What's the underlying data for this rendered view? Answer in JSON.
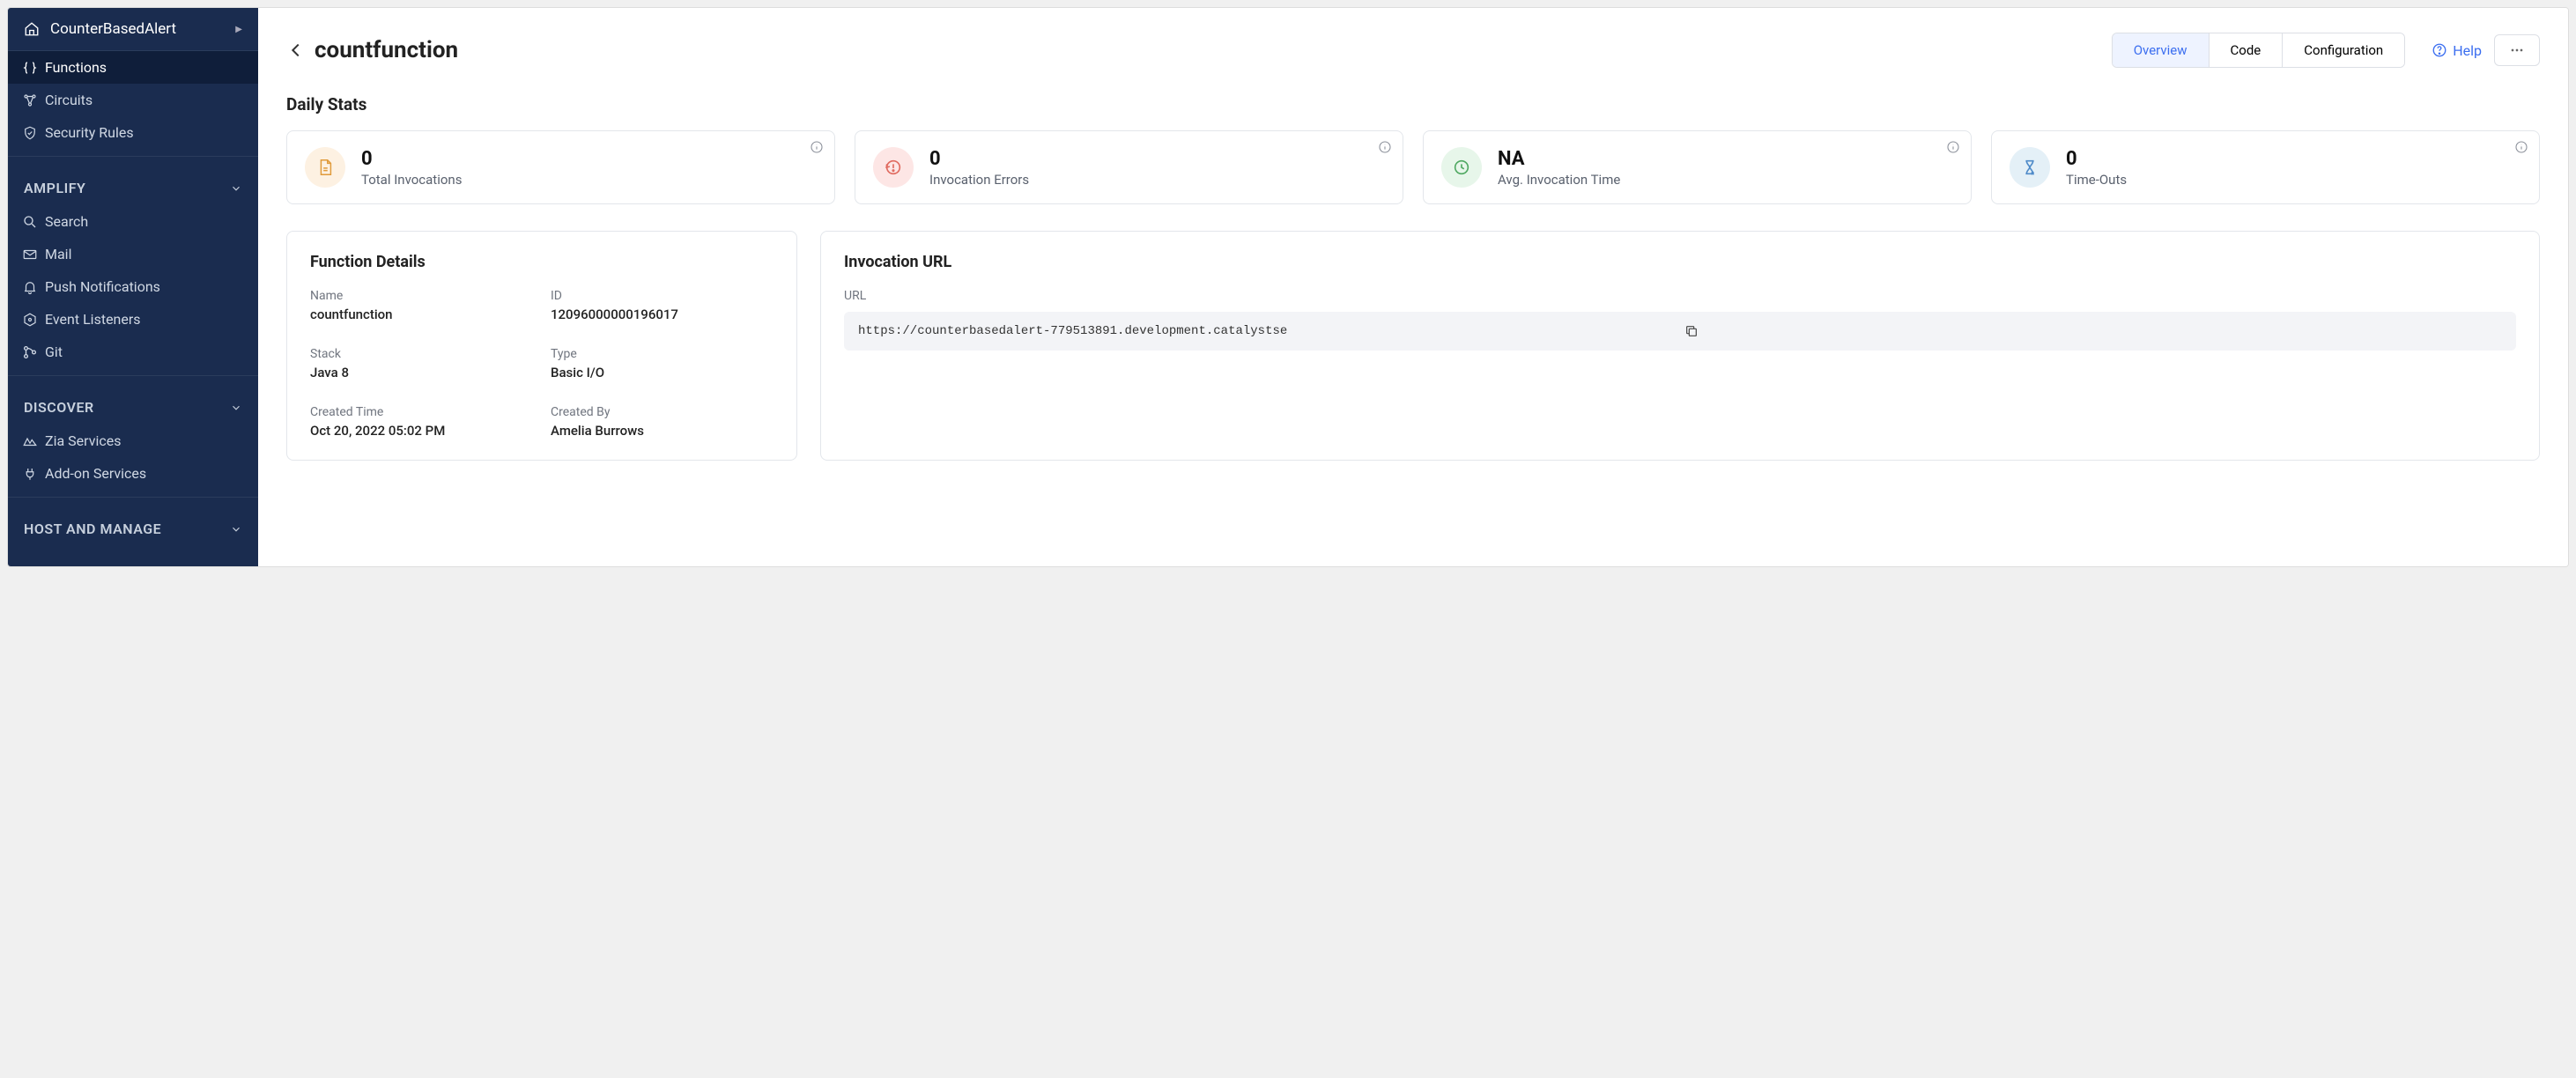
{
  "sidebar": {
    "project_name": "CounterBasedAlert",
    "group1": [
      {
        "label": "Functions",
        "active": true,
        "icon": "braces-icon"
      },
      {
        "label": "Circuits",
        "active": false,
        "icon": "circuit-icon"
      },
      {
        "label": "Security Rules",
        "active": false,
        "icon": "shield-icon"
      }
    ],
    "sections": [
      {
        "title": "AMPLIFY",
        "items": [
          {
            "label": "Search",
            "icon": "search-icon"
          },
          {
            "label": "Mail",
            "icon": "mail-icon"
          },
          {
            "label": "Push Notifications",
            "icon": "bell-icon"
          },
          {
            "label": "Event Listeners",
            "icon": "hexagon-icon"
          },
          {
            "label": "Git",
            "icon": "git-icon"
          }
        ]
      },
      {
        "title": "DISCOVER",
        "items": [
          {
            "label": "Zia Services",
            "icon": "zia-icon"
          },
          {
            "label": "Add-on Services",
            "icon": "plug-icon"
          }
        ]
      },
      {
        "title": "HOST AND MANAGE",
        "items": []
      }
    ]
  },
  "header": {
    "title": "countfunction",
    "tabs": [
      "Overview",
      "Code",
      "Configuration"
    ],
    "active_tab": 0,
    "help_label": "Help"
  },
  "daily_stats": {
    "title": "Daily Stats",
    "cards": [
      {
        "value": "0",
        "label": "Total Invocations"
      },
      {
        "value": "0",
        "label": "Invocation Errors"
      },
      {
        "value": "NA",
        "label": "Avg. Invocation Time"
      },
      {
        "value": "0",
        "label": "Time-Outs"
      }
    ]
  },
  "function_details": {
    "title": "Function Details",
    "fields": {
      "name_label": "Name",
      "name_value": "countfunction",
      "id_label": "ID",
      "id_value": "12096000000196017",
      "stack_label": "Stack",
      "stack_value": "Java 8",
      "type_label": "Type",
      "type_value": "Basic I/O",
      "created_time_label": "Created Time",
      "created_time_value": "Oct 20, 2022 05:02 PM",
      "created_by_label": "Created By",
      "created_by_value": "Amelia Burrows"
    }
  },
  "invocation_url": {
    "title": "Invocation URL",
    "label": "URL",
    "value": "https://counterbasedalert-779513891.development.catalystse"
  }
}
